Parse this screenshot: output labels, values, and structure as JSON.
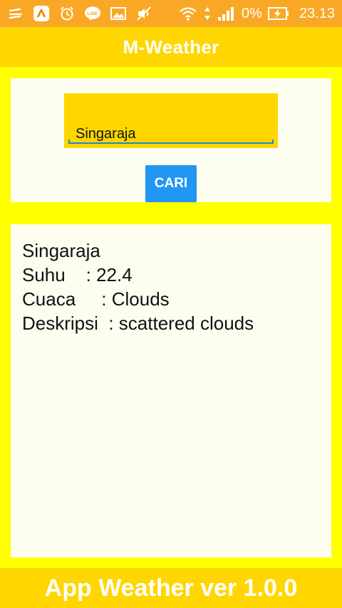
{
  "status_bar": {
    "icons_left": [
      "menu-lines-icon",
      "app-a-icon",
      "alarm-icon",
      "line-app-icon",
      "image-icon",
      "mute-icon"
    ],
    "icons_right": [
      "wifi-icon",
      "data-arrows-icon",
      "signal-icon",
      "battery-charging-icon"
    ],
    "line_label": "LINE",
    "battery": "0%",
    "time": "23.13"
  },
  "app_bar": {
    "title": "M-Weather"
  },
  "search": {
    "city_value": "Singaraja",
    "button_label": "CARI"
  },
  "result": {
    "city": "Singaraja",
    "temperature_line": "Suhu    : 22.4",
    "weather_line": "Cuaca     : Clouds",
    "description_line": "Deskripsi  : scattered clouds"
  },
  "footer": {
    "text": "App Weather ver 1.0.0"
  },
  "colors": {
    "status_bar": "#f9a825",
    "app_bar": "#ffd600",
    "background": "#ffff00",
    "button": "#2196f3",
    "card": "#fdfdf0"
  }
}
